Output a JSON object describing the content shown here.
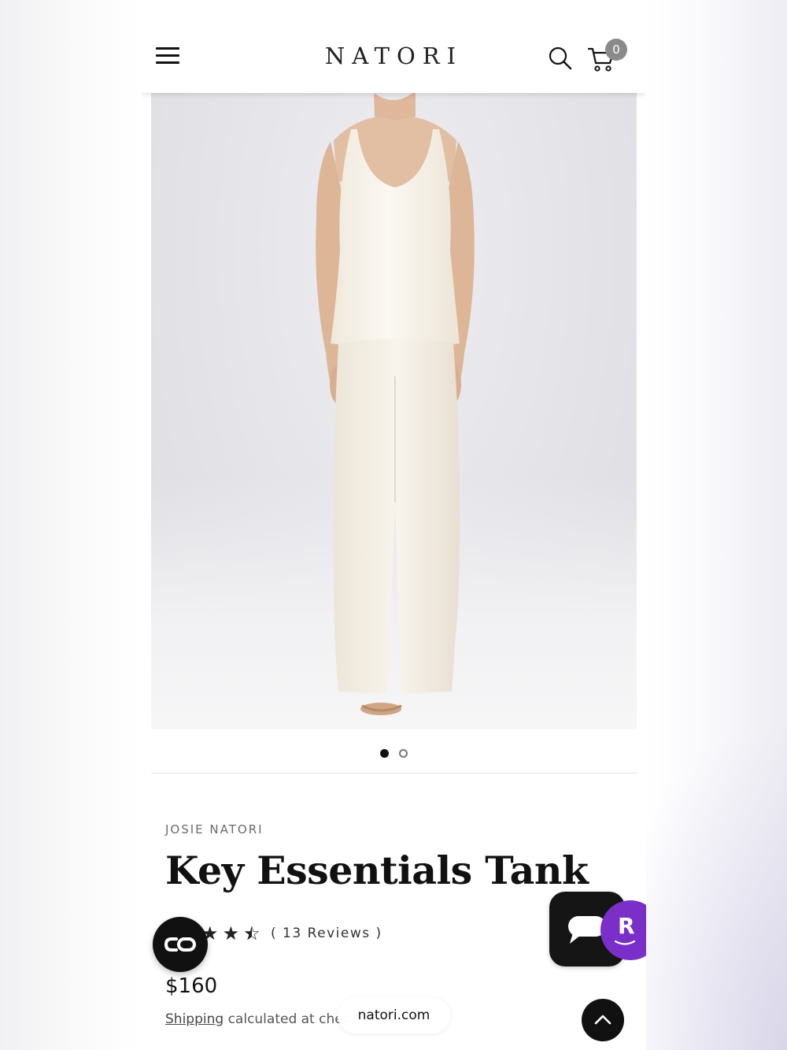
{
  "header": {
    "logo": "NATORI",
    "cart_count": "0"
  },
  "gallery": {
    "image_alt": "Model wearing ivory silk tank top and wide-leg pants",
    "slide_count": 2,
    "active_slide": 1
  },
  "product": {
    "brand": "JOSIE NATORI",
    "title": "Key Essentials Tank",
    "rating": 3.5,
    "rating_max": 5,
    "reviews_label": "( 13 Reviews )",
    "price": "$160",
    "shipping_link": "Shipping",
    "shipping_rest": " calculated at chec"
  },
  "widgets": {
    "co_label": "CO",
    "r_label": "R",
    "chat_color": "#151515",
    "r_color": "#7b2fc9"
  },
  "browser": {
    "url": "natori.com"
  }
}
